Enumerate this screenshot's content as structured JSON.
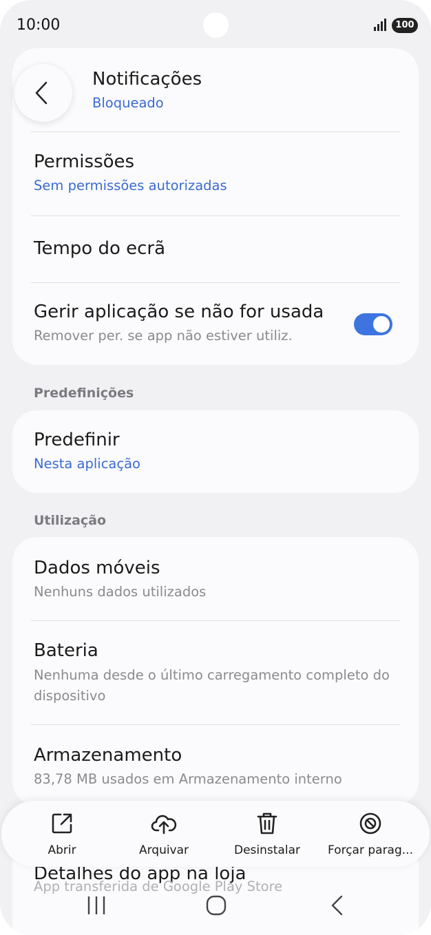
{
  "status_bar": {
    "time": "10:00",
    "battery": "100"
  },
  "card1": {
    "items": [
      {
        "title": "Notificações",
        "subtitle": "Bloqueado"
      },
      {
        "title": "Permissões",
        "subtitle": "Sem permissões autorizadas"
      },
      {
        "title": "Tempo do ecrã"
      },
      {
        "title": "Gerir aplicação se não for usada",
        "subtitle": "Remover per. se app não estiver utiliz.",
        "toggle_on": true
      }
    ]
  },
  "section_predefinicoes": {
    "label": "Predefinições"
  },
  "card2": {
    "items": [
      {
        "title": "Predefinir",
        "subtitle": "Nesta aplicação"
      }
    ]
  },
  "section_utilizacao": {
    "label": "Utilização"
  },
  "card3": {
    "items": [
      {
        "title": "Dados móveis",
        "subtitle": "Nenhuns dados utilizados"
      },
      {
        "title": "Bateria",
        "subtitle": "Nenhuma desde o último carregamento completo do dispositivo"
      },
      {
        "title": "Armazenamento",
        "subtitle": "83,78 MB usados em Armazenamento interno"
      }
    ]
  },
  "peek": {
    "title": "Detalhes do app na loja",
    "subtitle": "App transferida de Google Play Store"
  },
  "actions": [
    {
      "label": "Abrir",
      "icon": "open-external-icon"
    },
    {
      "label": "Arquivar",
      "icon": "cloud-upload-icon"
    },
    {
      "label": "Desinstalar",
      "icon": "trash-icon"
    },
    {
      "label": "Forçar parag...",
      "icon": "block-icon"
    }
  ],
  "colors": {
    "accent": "#3e74e0",
    "link": "#3a6bd1",
    "background": "#f1f1f4",
    "card": "#fbfbfd"
  }
}
